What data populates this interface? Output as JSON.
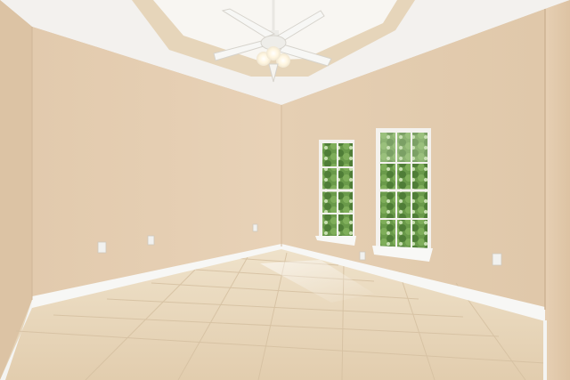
{
  "scene": {
    "subject": "empty-room",
    "has_text": false
  },
  "colors": {
    "ceiling": "#f4f2ef",
    "tray_ceiling": "#f8f6f2",
    "tray_band": "#e5d3b8",
    "left_wall": "#e6cfb3",
    "back_wall": "#e4cdb0",
    "right_wall": "#e3c9ab",
    "near_left_wall": "#dcc3a4",
    "baseboard": "#f7f7f5",
    "floor_tile": "#ead9bf",
    "grout": "#d7c2a3",
    "window_frame": "#f4f2ee",
    "foliage": "#5f8b44",
    "fan_blade": "#f7f7f5",
    "outlet": "#f0f0ee"
  },
  "icons": [
    "ceiling-fan-icon",
    "window-icon",
    "electrical-outlet-icon"
  ]
}
